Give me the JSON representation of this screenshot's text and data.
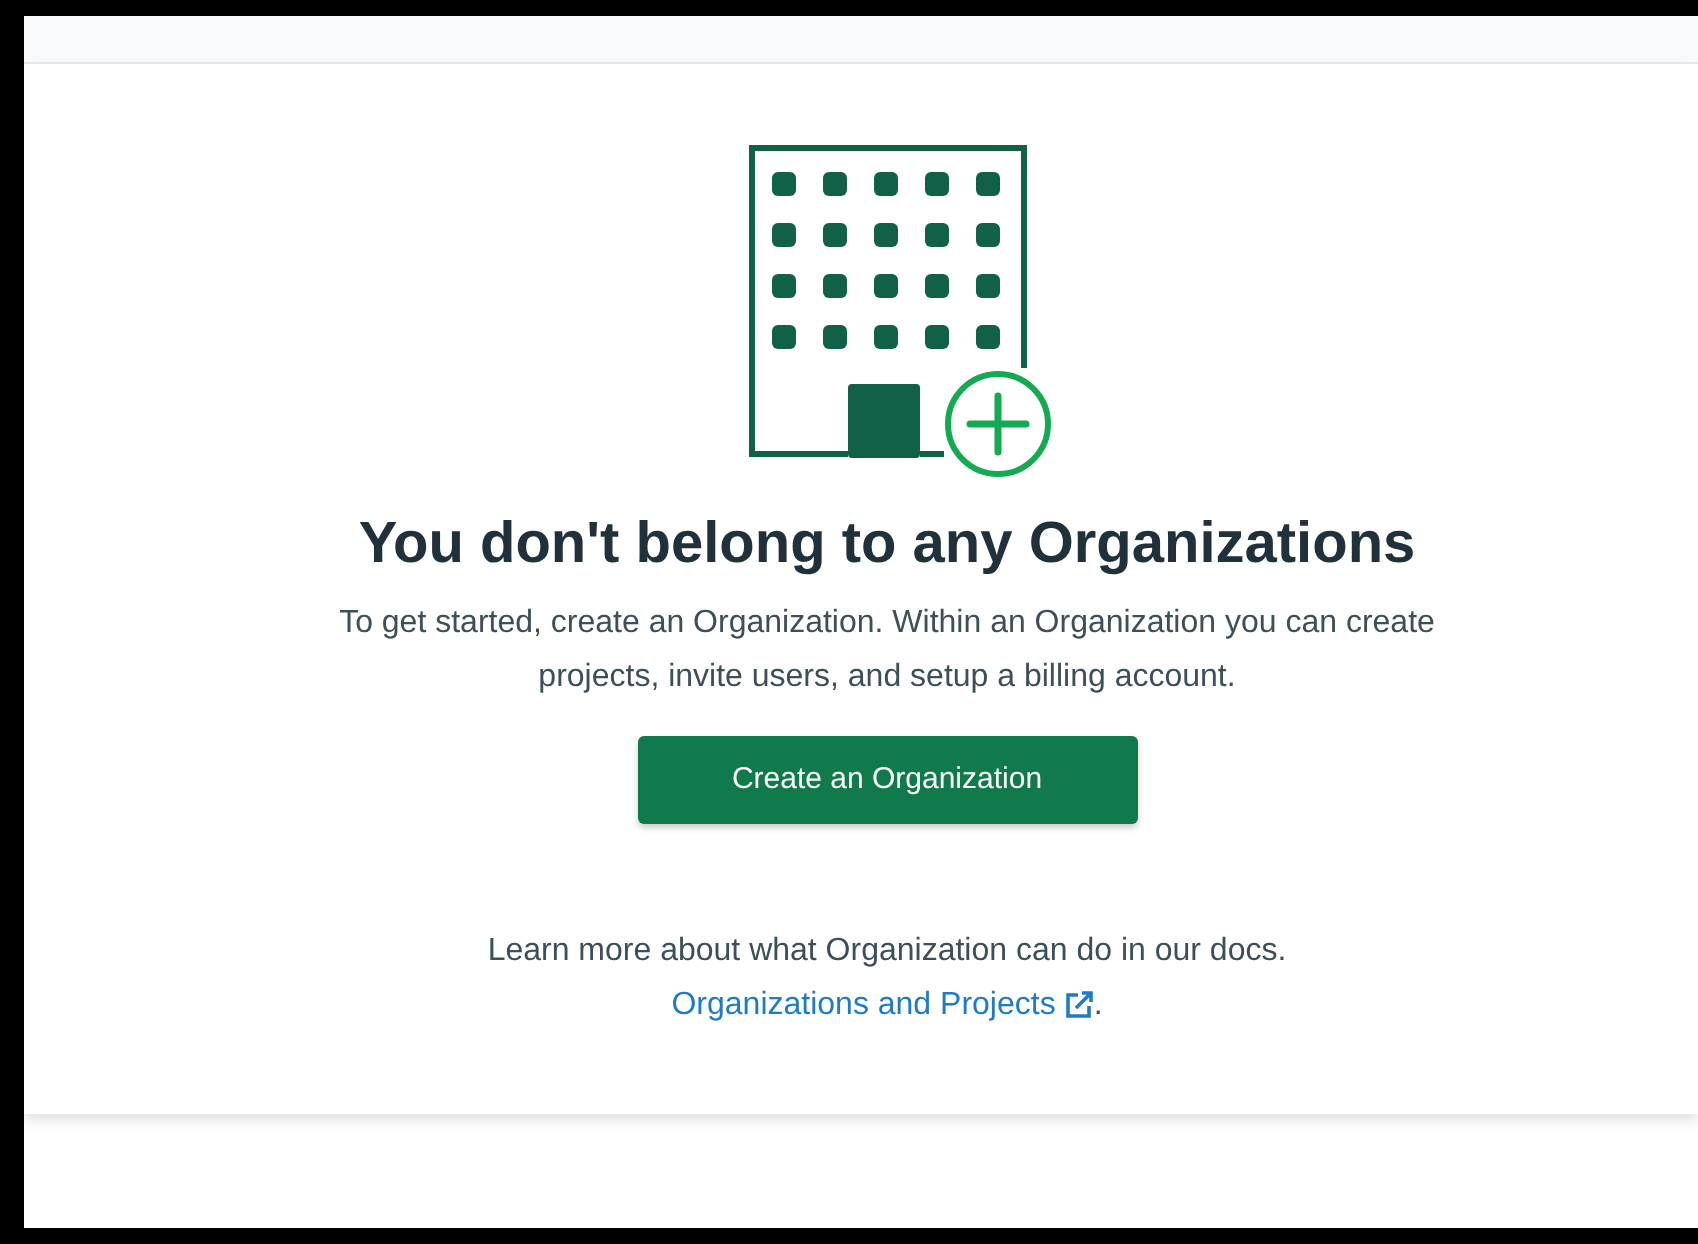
{
  "empty_state": {
    "title": "You don't belong to any Organizations",
    "description": "To get started, create an Organization. Within an Organization you can create projects, invite users, and setup a billing account.",
    "button": "Create an Organization",
    "learn_more": "Learn more about what Organization can do in our docs.",
    "link": "Organizations and Projects",
    "link_suffix": "."
  }
}
